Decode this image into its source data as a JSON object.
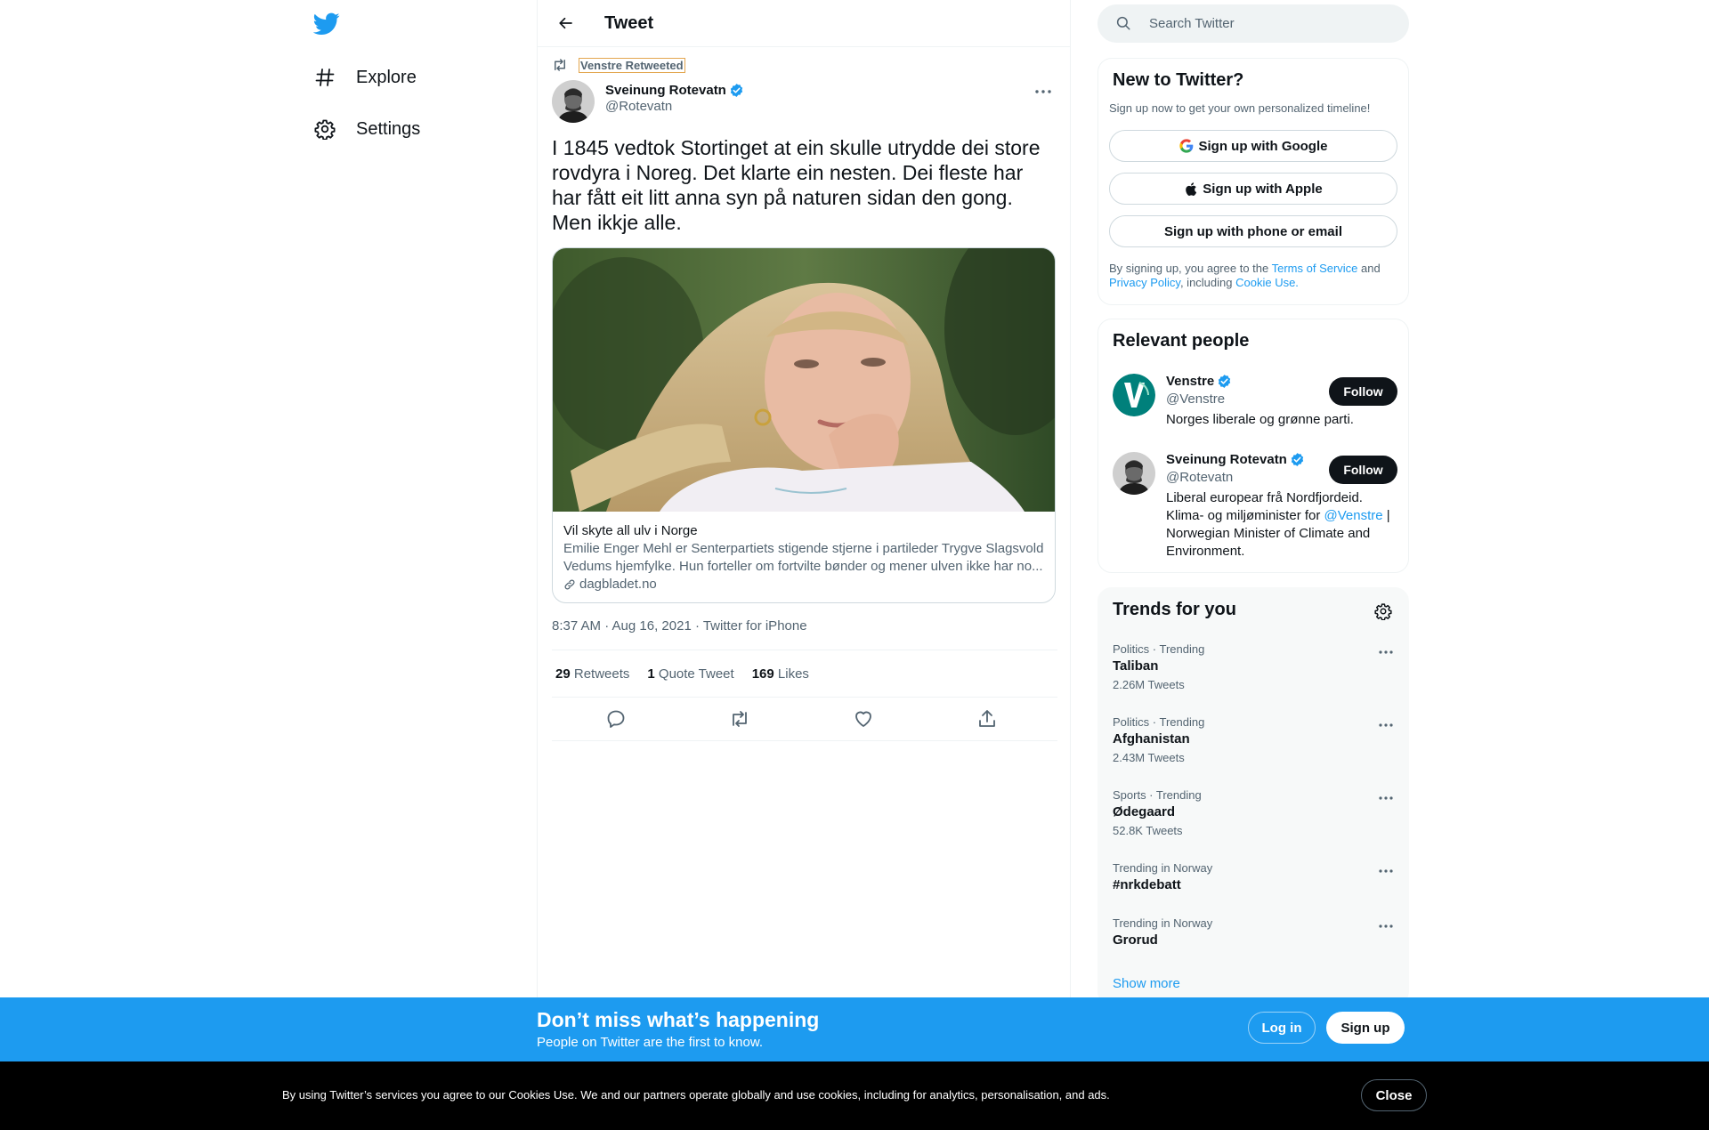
{
  "colors": {
    "accent": "#1d9bf0",
    "text": "#0f1419",
    "secondary": "#536471",
    "border": "#eff3f4",
    "cookie_bg": "#000000"
  },
  "nav": {
    "logo_icon": "twitter-bird-icon",
    "items": [
      {
        "icon": "hashtag-icon",
        "label": "Explore"
      },
      {
        "icon": "gear-icon",
        "label": "Settings"
      }
    ]
  },
  "header": {
    "back_icon": "arrow-left-icon",
    "title": "Tweet"
  },
  "tweet": {
    "retweeted_by": "Venstre Retweeted",
    "author": {
      "name": "Sveinung Rotevatn",
      "handle": "@Rotevatn",
      "verified": true
    },
    "text": "I 1845 vedtok Stortinget at ein skulle utrydde dei store rovdyra i Noreg. Det klarte ein nesten. Dei fleste har har fått eit litt anna syn på naturen sidan den gong. Men ikkje alle.",
    "card": {
      "title": "Vil skyte all ulv i Norge",
      "description": "Emilie Enger Mehl er Senterpartiets stigende stjerne i partileder Trygve Slagsvold Vedums hjemfylke. Hun forteller om fortvilte bønder og mener ulven ikke har no...",
      "domain": "dagbladet.no"
    },
    "meta": "8:37 AM · Aug 16, 2021 · Twitter for iPhone",
    "stats": [
      {
        "count": "29",
        "label": "Retweets"
      },
      {
        "count": "1",
        "label": "Quote Tweet"
      },
      {
        "count": "169",
        "label": "Likes"
      }
    ]
  },
  "search": {
    "placeholder": "Search Twitter"
  },
  "signup_panel": {
    "title": "New to Twitter?",
    "subtitle": "Sign up now to get your own personalized timeline!",
    "google": "Sign up with Google",
    "apple": "Sign up with Apple",
    "phone": "Sign up with phone or email",
    "legal_1": "By signing up, you agree to the ",
    "terms": "Terms of Service",
    "legal_2": " and ",
    "privacy": "Privacy Policy",
    "legal_3": ", including ",
    "cookie_use": "Cookie Use."
  },
  "relevant_people": {
    "title": "Relevant people",
    "people": [
      {
        "name": "Venstre",
        "handle": "@Venstre",
        "bio": "Norges liberale og grønne parti.",
        "follow": "Follow"
      },
      {
        "name": "Sveinung Rotevatn",
        "handle": "@Rotevatn",
        "bio_1": "Liberal europear frå Nordfjordeid. Klima- og miljøminister for ",
        "bio_link": "@Venstre",
        "bio_2": " | Norwegian Minister of Climate and Environment.",
        "follow": "Follow"
      }
    ]
  },
  "trends": {
    "title": "Trends for you",
    "items": [
      {
        "context": "Politics · Trending",
        "name": "Taliban",
        "count": "2.26M Tweets"
      },
      {
        "context": "Politics · Trending",
        "name": "Afghanistan",
        "count": "2.43M Tweets"
      },
      {
        "context": "Sports · Trending",
        "name": "Ødegaard",
        "count": "52.8K Tweets"
      },
      {
        "context": "Trending in Norway",
        "name": "#nrkdebatt",
        "count": ""
      },
      {
        "context": "Trending in Norway",
        "name": "Grorud",
        "count": ""
      }
    ],
    "show_more": "Show more"
  },
  "promo": {
    "title": "Don’t miss what’s happening",
    "subtitle": "People on Twitter are the first to know.",
    "login": "Log in",
    "signup": "Sign up"
  },
  "cookie_bar": {
    "text": "By using Twitter’s services you agree to our Cookies Use. We and our partners operate globally and use cookies, including for analytics, personalisation, and ads.",
    "close": "Close"
  }
}
